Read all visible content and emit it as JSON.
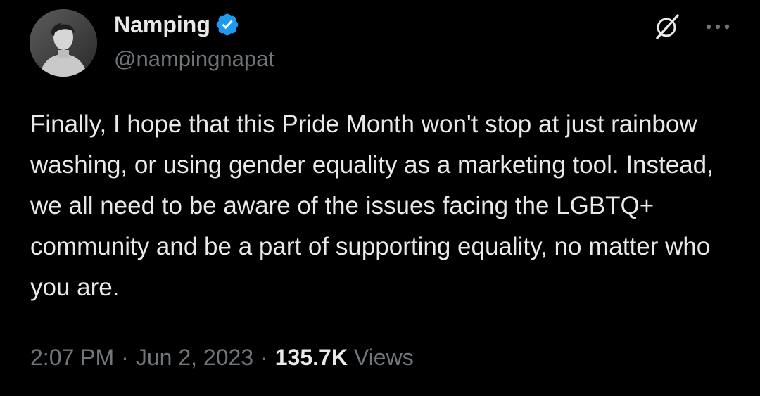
{
  "post": {
    "author": {
      "display_name": "Namping",
      "handle": "@nampingnapat",
      "verified": true,
      "avatar_icon": "profile-photo"
    },
    "text": "Finally, I hope that this Pride Month won't stop at just rainbow washing, or using gender equality as a marketing tool. Instead, we all need to be aware of the issues facing the LGBTQ+ community and be a part of supporting equality, no matter who you are.",
    "time": "2:07 PM",
    "separator": "·",
    "date": "Jun 2, 2023",
    "views_count": "135.7K",
    "views_label": "Views"
  },
  "actions": {
    "grok_icon": "grok-icon",
    "more_icon": "more-icon"
  },
  "colors": {
    "background": "#000000",
    "primary_text": "#e7e9ea",
    "secondary_text": "#71767b",
    "verified_badge": "#1d9bf0"
  }
}
